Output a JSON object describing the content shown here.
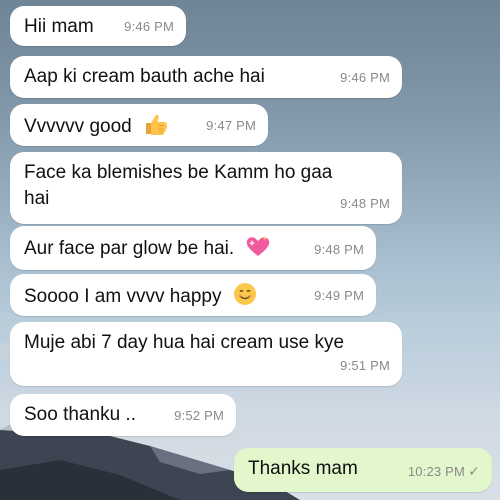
{
  "messages": [
    {
      "text": "Hii mam",
      "time": "9:46 PM",
      "direction": "incoming"
    },
    {
      "text": "Aap ki cream bauth ache hai",
      "time": "9:46 PM",
      "direction": "incoming"
    },
    {
      "text": "Vvvvvv good",
      "time": "9:47 PM",
      "direction": "incoming",
      "emoji": "thumbs-up-icon"
    },
    {
      "text_line1": "Face ka blemishes  be Kamm  ho gaa",
      "text_line2": "hai",
      "time": "9:48 PM",
      "direction": "incoming"
    },
    {
      "text": "Aur face par glow be hai.",
      "time": "9:48 PM",
      "direction": "incoming",
      "emoji": "sparkling-heart-icon"
    },
    {
      "text": "Soooo I am vvvv happy",
      "time": "9:49 PM",
      "direction": "incoming",
      "emoji": "smiling-face-icon"
    },
    {
      "text": "Muje abi 7 day hua hai cream use kye",
      "time": "9:51 PM",
      "direction": "incoming"
    },
    {
      "text": "Soo thanku ..",
      "time": "9:52 PM",
      "direction": "incoming"
    },
    {
      "text": "Thanks mam",
      "time": "10:23 PM",
      "direction": "outgoing",
      "status": "✓"
    }
  ],
  "colors": {
    "incoming_bubble": "#ffffff",
    "outgoing_bubble": "#e2f7cb",
    "timestamp": "#8a8a8a",
    "read_check": "#7b9b79"
  }
}
